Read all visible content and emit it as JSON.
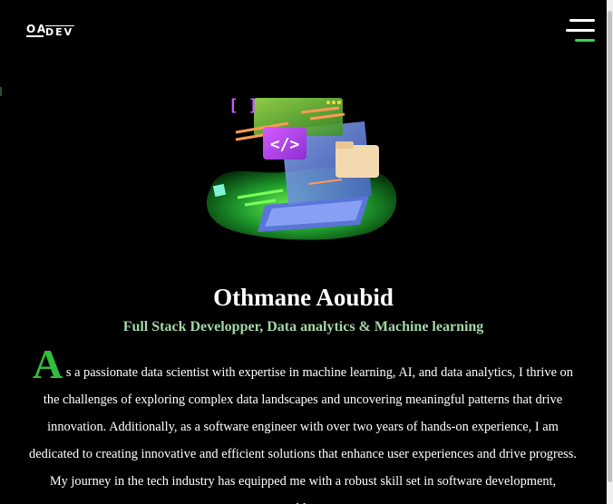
{
  "header": {
    "logo_top": "OA",
    "logo_bottom": "DEV",
    "menu_icon": "hamburger-menu-icon"
  },
  "hero": {
    "illustration_icon": "laptop-code-illustration",
    "name": "Othmane Aoubid",
    "subtitle": "Full Stack Developper, Data analytics & Machine learning"
  },
  "about": {
    "dropcap": "A",
    "text": "s a passionate data scientist with expertise in machine learning, AI, and data analytics, I thrive on the challenges of exploring complex data landscapes and uncovering meaningful patterns that drive innovation. Additionally, as a software engineer with over two years of hands-on experience, I am dedicated to creating innovative and efficient solutions that enhance user experiences and drive progress. My journey in the tech industry has equipped me with a robust skill set in software development, problem-"
  },
  "colors": {
    "background": "#000000",
    "accent_green": "#2fbf3a",
    "subtitle_green": "#a5d6a7",
    "text": "#ffffff"
  }
}
